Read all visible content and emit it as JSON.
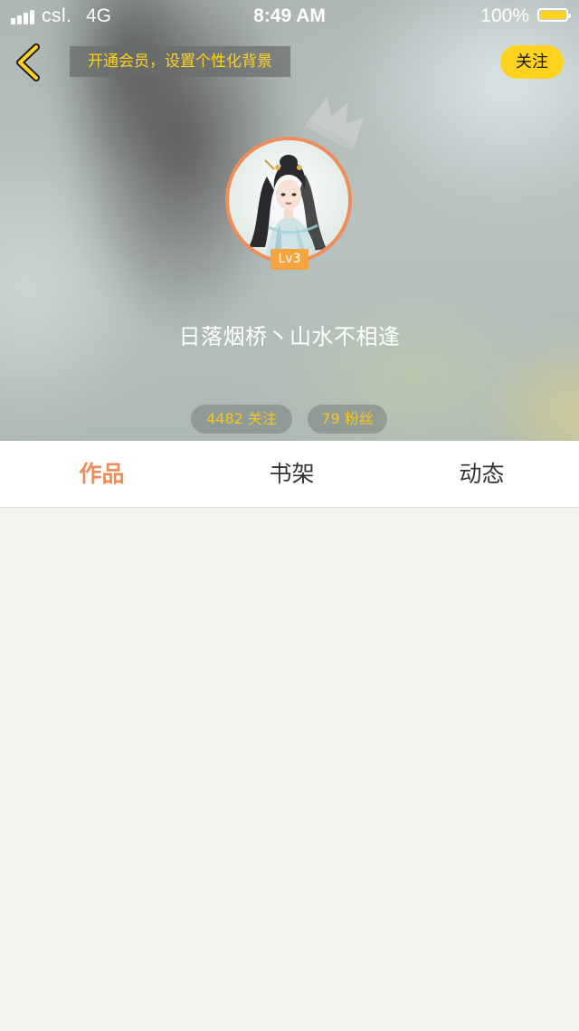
{
  "status_bar": {
    "carrier": "csl.",
    "network": "4G",
    "time": "8:49 AM",
    "battery": "100%",
    "battery_color": "#ffd21f"
  },
  "header": {
    "back_icon": "chevron-left-icon",
    "vip_banner": "开通会员，设置个性化背景",
    "follow_label": "关注"
  },
  "profile": {
    "crown_icon": "crown-icon",
    "level": "Lv3",
    "username": "日落烟桥丶山水不相逢",
    "following": "4482 关注",
    "fans": "79 粉丝"
  },
  "tabs": [
    {
      "label": "作品",
      "active": true
    },
    {
      "label": "书架",
      "active": false
    },
    {
      "label": "动态",
      "active": false
    }
  ],
  "colors": {
    "accent_orange": "#f08c58",
    "accent_yellow": "#ffd21f",
    "stat_text": "#f5c524",
    "background": "#f4f3ef"
  }
}
